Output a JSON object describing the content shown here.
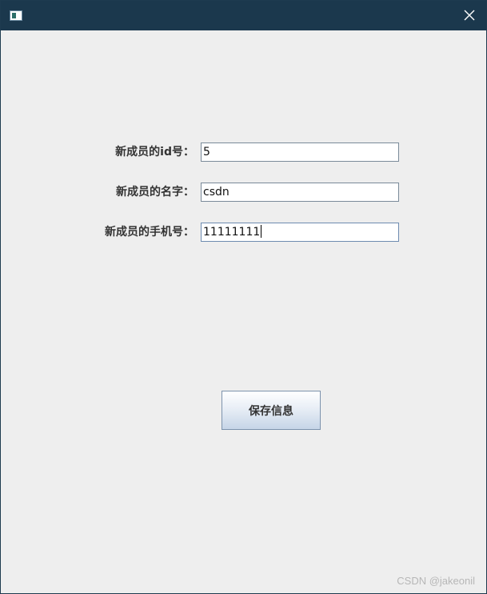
{
  "titlebar": {
    "app_icon": "window-app-icon",
    "close_icon": "close-icon",
    "close_glyph": "✕"
  },
  "form": {
    "id_label": "新成员的id号：",
    "id_value": "5",
    "name_label": "新成员的名字：",
    "name_value": "csdn",
    "phone_label": "新成员的手机号：",
    "phone_value": "11111111"
  },
  "actions": {
    "save_label": "保存信息"
  },
  "watermark": "CSDN @jakeonil",
  "colors": {
    "titlebar_bg": "#1b384d",
    "window_bg": "#eeeeee",
    "button_gradient_bottom": "#c6d5e7"
  }
}
